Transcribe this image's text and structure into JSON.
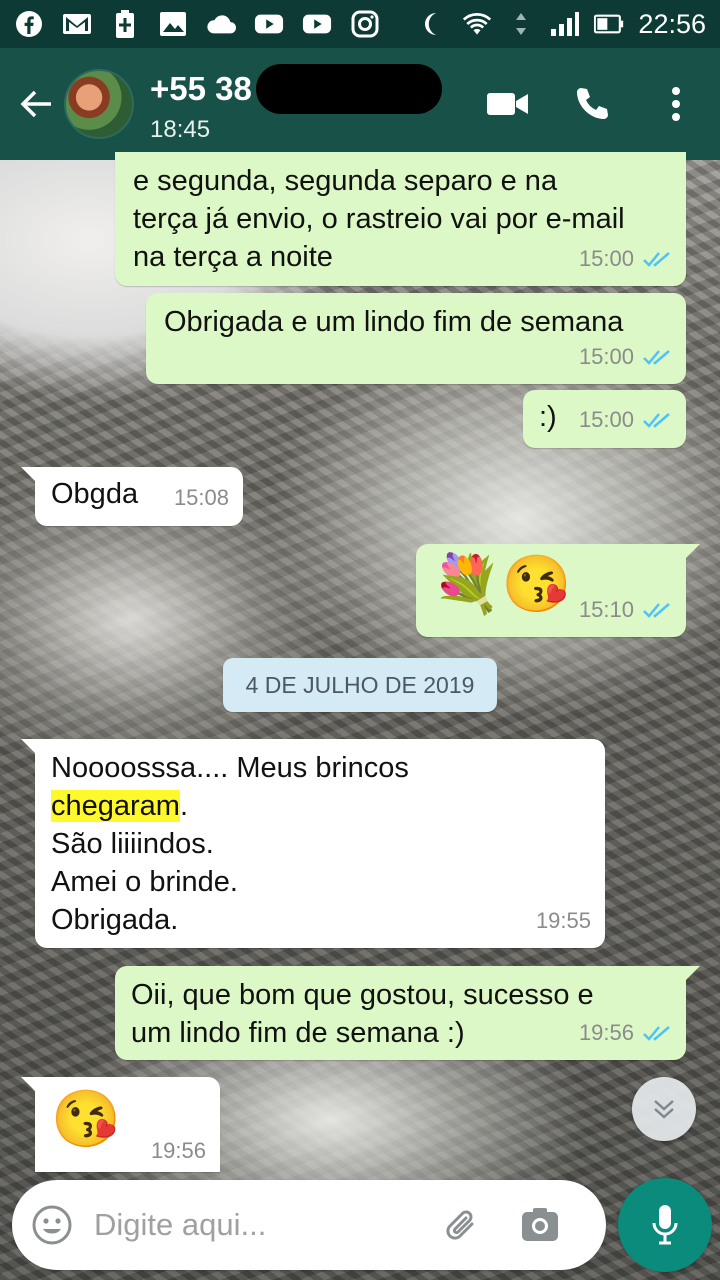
{
  "status_bar": {
    "time": "22:56",
    "icons": [
      "facebook-icon",
      "gmail-icon",
      "battery-saver-icon",
      "gallery-icon",
      "cloud-icon",
      "youtube-icon",
      "youtube-icon",
      "instagram-icon",
      "do-not-disturb-icon",
      "wifi-icon",
      "signal-icon",
      "battery-icon"
    ]
  },
  "header": {
    "contact_name": "+55 38",
    "last_seen": "18:45",
    "icons": {
      "back": "back-arrow-icon",
      "video": "video-call-icon",
      "call": "phone-icon",
      "menu": "more-vert-icon"
    }
  },
  "messages": [
    {
      "direction": "out",
      "lines": [
        "e segunda, segunda separo e na",
        "terça já envio, o rastreio vai por e-mail",
        "na terça a noite"
      ],
      "time": "15:00",
      "status": "read"
    },
    {
      "direction": "out",
      "lines": [
        "Obrigada e um lindo fim de semana"
      ],
      "time": "15:00",
      "status": "read"
    },
    {
      "direction": "out",
      "lines": [
        ":)"
      ],
      "time": "15:00",
      "status": "read"
    },
    {
      "direction": "in",
      "lines": [
        "Obgda"
      ],
      "time": "15:08"
    },
    {
      "direction": "out",
      "emoji": "💐😘",
      "time": "15:10",
      "status": "read"
    },
    {
      "direction": "in",
      "line1": "Noooosssa.... Meus brincos",
      "line2_highlight": "chegaram",
      "line2_rest": ".",
      "line3": "São liiiindos.",
      "line4": "Amei o brinde.",
      "line5": "Obrigada.",
      "time": "19:55"
    },
    {
      "direction": "out",
      "lines": [
        "Oii, que bom que gostou, sucesso e",
        "um lindo fim de semana :)"
      ],
      "time": "19:56",
      "status": "read"
    },
    {
      "direction": "in",
      "emoji": "😘",
      "time": "19:56"
    }
  ],
  "date_divider": "4 DE JULHO DE 2019",
  "input": {
    "placeholder": "Digite aqui..."
  },
  "colors": {
    "header": "#185148",
    "status_bar": "#0e3a36",
    "outgoing_bubble": "#dcf8c6",
    "incoming_bubble": "#ffffff",
    "read_ticks": "#4fc3f7",
    "mic_button": "#0b8b7b"
  }
}
